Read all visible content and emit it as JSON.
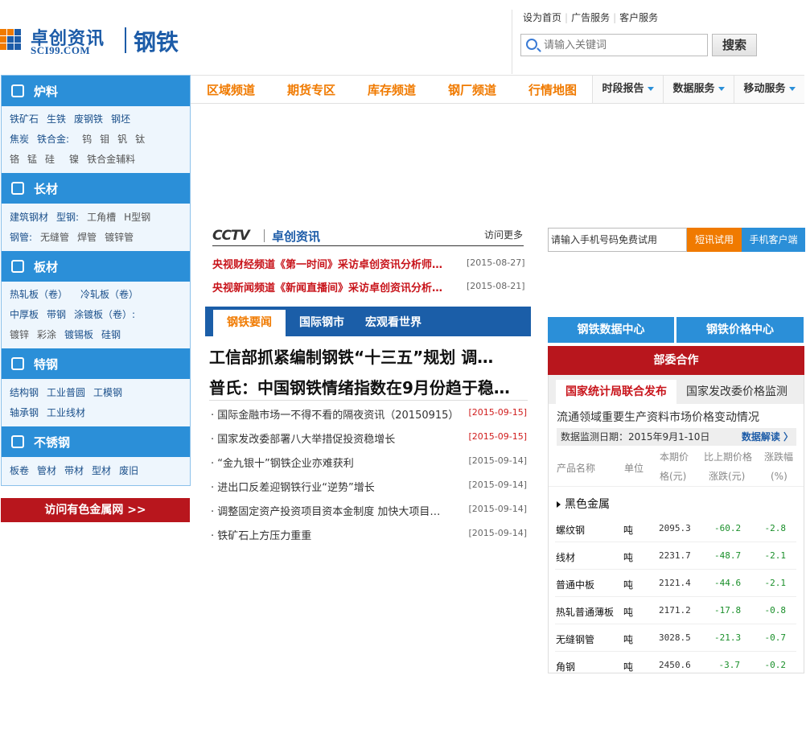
{
  "header": {
    "brand": "卓创资讯",
    "domain_text": "SCI99.COM",
    "channel": "钢铁",
    "top_links": [
      "设为首页",
      "广告服务",
      "客户服务"
    ],
    "search": {
      "placeholder": "请输入关键词",
      "button": "搜索"
    },
    "colors": {
      "brand": "#1d5ca8",
      "accent": "#f07a00"
    }
  },
  "sidebar": {
    "categories": [
      {
        "title": "炉料",
        "icon": "furnace-icon",
        "lines": [
          [
            "铁矿石",
            "生铁",
            "废钢铁",
            "钢坯"
          ],
          [
            "焦炭",
            "铁合金:",
            "钨",
            "钼",
            "钒",
            "钛"
          ],
          [
            "铬",
            "锰",
            "硅",
            "镍",
            "铁合金辅料"
          ]
        ]
      },
      {
        "title": "长材",
        "icon": "rebar-icon",
        "lines": [
          [
            "建筑钢材",
            "型钢:",
            "工角槽",
            "H型钢"
          ],
          [
            "钢管:",
            "无缝管",
            "焊管",
            "镀锌管"
          ]
        ]
      },
      {
        "title": "板材",
        "icon": "plate-icon",
        "lines": [
          [
            "热轧板（卷）",
            "冷轧板（卷）"
          ],
          [
            "中厚板",
            "带钢",
            "涂镀板（卷）:"
          ],
          [
            "镀锌",
            "彩涂",
            "镀锡板",
            "硅钢"
          ]
        ]
      },
      {
        "title": "特钢",
        "icon": "special-steel-icon",
        "lines": [
          [
            "结构钢",
            "工业普圆",
            "工模钢"
          ],
          [
            "轴承钢",
            "工业线材"
          ]
        ]
      },
      {
        "title": "不锈钢",
        "icon": "stainless-icon",
        "lines": [
          [
            "板卷",
            "管材",
            "带材",
            "型材",
            "废旧"
          ]
        ]
      }
    ],
    "visit_metal": "访问有色金属网 >>"
  },
  "nav": {
    "items": [
      "区域频道",
      "期货专区",
      "库存频道",
      "钢厂频道",
      "行情地图"
    ],
    "dropdowns": [
      "时段报告",
      "数据服务",
      "移动服务"
    ]
  },
  "cctv": {
    "logo": "CCTV",
    "brand": "卓创资讯",
    "more": "访问更多",
    "items": [
      {
        "title": "央视财经频道《第一时间》采访卓创资讯分析师…",
        "date": "[2015-08-27]"
      },
      {
        "title": "央视新闻频道《新闻直播间》采访卓创资讯分析…",
        "date": "[2015-08-21]"
      }
    ]
  },
  "news": {
    "tabs": [
      "钢铁要闻",
      "国际钢市",
      "宏观看世界"
    ],
    "headlines": [
      "工信部抓紧编制钢铁“十三五”规划 调…",
      "普氏：中国钢铁情绪指数在9月份趋于稳…"
    ],
    "items": [
      {
        "title": "· 国际金融市场一不得不看的隔夜资讯（20150915）",
        "date": "[2015-09-15]",
        "highlight": true
      },
      {
        "title": "· 国家发改委部署八大举措促投资稳增长",
        "date": "[2015-09-15]",
        "highlight": true
      },
      {
        "title": "· “金九银十”钢铁企业亦难获利",
        "date": "[2015-09-14]",
        "highlight": false
      },
      {
        "title": "· 进出口反差迎钢铁行业“逆势”增长",
        "date": "[2015-09-14]",
        "highlight": false
      },
      {
        "title": "· 调整固定资产投资项目资本金制度 加快大项目…",
        "date": "[2015-09-14]",
        "highlight": false
      },
      {
        "title": "· 铁矿石上方压力重重",
        "date": "[2015-09-14]",
        "highlight": false
      }
    ]
  },
  "right": {
    "phone_placeholder": "请输入手机号码免费试用",
    "sms_trial": "短讯试用",
    "mobile_client": "手机客户端",
    "data_center": "钢铁数据中心",
    "price_center": "钢铁价格中心",
    "ministry": {
      "title": "部委合作",
      "tabs": [
        "国家统计局联合发布",
        "国家发改委价格监测"
      ],
      "subtitle": "流通领域重要生产资料市场价格变动情况",
      "date_label": "数据监测日期：2015年9月1-10日",
      "interpret": "数据解读 〉",
      "headers": [
        "产品名称",
        "单位",
        "本期价",
        "格(元)",
        "比上期价格",
        "涨跌(元)",
        "涨跌幅",
        "(%)"
      ],
      "group": "黑色金属",
      "rows": [
        {
          "name": "螺纹钢",
          "unit": "吨",
          "price": "2095.3",
          "change": "-60.2",
          "pct": "-2.8"
        },
        {
          "name": "线材",
          "unit": "吨",
          "price": "2231.7",
          "change": "-48.7",
          "pct": "-2.1"
        },
        {
          "name": "普通中板",
          "unit": "吨",
          "price": "2121.4",
          "change": "-44.6",
          "pct": "-2.1"
        },
        {
          "name": "热轧普通薄板",
          "unit": "吨",
          "price": "2171.2",
          "change": "-17.8",
          "pct": "-0.8"
        },
        {
          "name": "无缝钢管",
          "unit": "吨",
          "price": "3028.5",
          "change": "-21.3",
          "pct": "-0.7"
        },
        {
          "name": "角钢",
          "unit": "吨",
          "price": "2450.6",
          "change": "-3.7",
          "pct": "-0.2"
        }
      ]
    }
  }
}
